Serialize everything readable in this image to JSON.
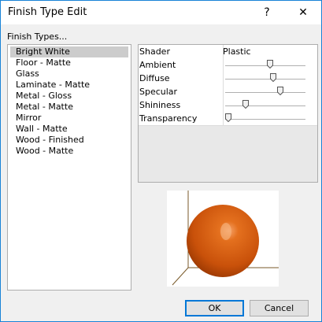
{
  "window": {
    "title": "Finish Type Edit",
    "help_glyph": "?",
    "close_glyph": "✕"
  },
  "finish_types": {
    "label": "Finish Types...",
    "items": [
      "Bright White",
      "Floor - Matte",
      "Glass",
      "Laminate - Matte",
      "Metal - Gloss",
      "Metal - Matte",
      "Mirror",
      "Wall - Matte",
      "Wood - Finished",
      "Wood - Matte"
    ],
    "selected_index": 0
  },
  "properties": {
    "shader": {
      "label": "Shader",
      "value": "Plastic"
    },
    "sliders": [
      {
        "label": "Ambient",
        "value": 0.56
      },
      {
        "label": "Diffuse",
        "value": 0.61
      },
      {
        "label": "Specular",
        "value": 0.7
      },
      {
        "label": "Shininess",
        "value": 0.23
      },
      {
        "label": "Transparency",
        "value": 0.0
      }
    ]
  },
  "preview": {
    "sphere_color": "#c9510a"
  },
  "buttons": {
    "ok": "OK",
    "cancel": "Cancel"
  }
}
